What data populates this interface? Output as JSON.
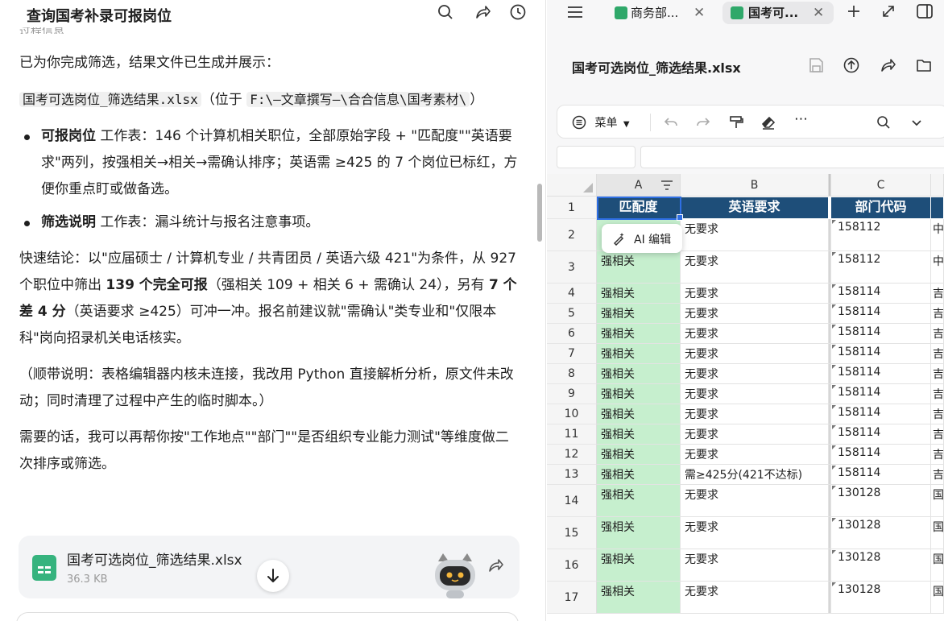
{
  "left": {
    "title": "查询国考补录可报岗位",
    "cut_text": "过程信息",
    "intro": "已为你完成筛选，结果文件已生成并展示：",
    "file_code": "国考可选岗位_筛选结果.xlsx",
    "path_pre": "（位于 ",
    "path_code": "F:\\—文章撰写—\\合合信息\\国考素材\\",
    "path_post": "）",
    "bullet1_bold": "可报岗位",
    "bullet1_text": " 工作表：146 个计算机相关职位，全部原始字段 + \"匹配度\"\"英语要求\"两列，按强相关→相关→需确认排序；英语需 ≥425 的 7 个岗位已标红，方便你重点盯或做备选。",
    "bullet2_bold": "筛选说明",
    "bullet2_text": " 工作表：漏斗统计与报名注意事项。",
    "quick_pre": "快速结论：以\"应届硕士 / 计算机专业 / 共青团员 / 英语六级 421\"为条件，从 927 个职位中筛出 ",
    "quick_b1": "139 个完全可报",
    "quick_mid": "（强相关 109 + 相关 6 + 需确认 24），另有 ",
    "quick_b2": "7 个差 4 分",
    "quick_post": "（英语要求 ≥425）可冲一冲。报名前建议就\"需确认\"类专业和\"仅限本科\"岗向招录机关电话核实。",
    "note": "（顺带说明：表格编辑器内核未连接，我改用 Python 直接解析分析，原文件未改动；同时清理了过程中产生的临时脚本。）",
    "offer": "需要的话，我可以再帮你按\"工作地点\"\"部门\"\"是否组织专业能力测试\"等维度做二次排序或筛选。",
    "card_name": "国考可选岗位_筛选结果.xlsx",
    "card_size": "36.3 KB"
  },
  "right": {
    "tabs": [
      {
        "label": "商务部..."
      },
      {
        "label": "国考可..."
      }
    ],
    "file_title": "国考可选岗位_筛选结果.xlsx",
    "menu_label": "菜单",
    "ai_edit": "AI 编辑",
    "columns": [
      "A",
      "B",
      "C"
    ],
    "header_row": [
      "匹配度",
      "英语要求",
      "部门代码"
    ],
    "rows": [
      {
        "n": "2",
        "a": "",
        "b": "无要求",
        "c": "158112",
        "d": "中"
      },
      {
        "n": "3",
        "a": "强相关",
        "b": "无要求",
        "c": "158112",
        "d": "中"
      },
      {
        "n": "4",
        "a": "强相关",
        "b": "无要求",
        "c": "158114",
        "d": "吉"
      },
      {
        "n": "5",
        "a": "强相关",
        "b": "无要求",
        "c": "158114",
        "d": "吉"
      },
      {
        "n": "6",
        "a": "强相关",
        "b": "无要求",
        "c": "158114",
        "d": "吉"
      },
      {
        "n": "7",
        "a": "强相关",
        "b": "无要求",
        "c": "158114",
        "d": "吉"
      },
      {
        "n": "8",
        "a": "强相关",
        "b": "无要求",
        "c": "158114",
        "d": "吉"
      },
      {
        "n": "9",
        "a": "强相关",
        "b": "无要求",
        "c": "158114",
        "d": "吉"
      },
      {
        "n": "10",
        "a": "强相关",
        "b": "无要求",
        "c": "158114",
        "d": "吉"
      },
      {
        "n": "11",
        "a": "强相关",
        "b": "无要求",
        "c": "158114",
        "d": "吉"
      },
      {
        "n": "12",
        "a": "强相关",
        "b": "无要求",
        "c": "158114",
        "d": "吉"
      },
      {
        "n": "13",
        "a": "强相关",
        "b": "需≥425分(421不达标)",
        "c": "158114",
        "d": "吉"
      },
      {
        "n": "14",
        "a": "强相关",
        "b": "无要求",
        "c": "130128",
        "d": "国"
      },
      {
        "n": "15",
        "a": "强相关",
        "b": "无要求",
        "c": "130128",
        "d": "国"
      },
      {
        "n": "16",
        "a": "强相关",
        "b": "无要求",
        "c": "130128",
        "d": "国"
      },
      {
        "n": "17",
        "a": "强相关",
        "b": "无要求",
        "c": "130128",
        "d": "国"
      }
    ]
  },
  "colors": {
    "header_blue": "#1e4e79",
    "match_green": "#c6efce",
    "select_blue": "#2f6fe4"
  }
}
